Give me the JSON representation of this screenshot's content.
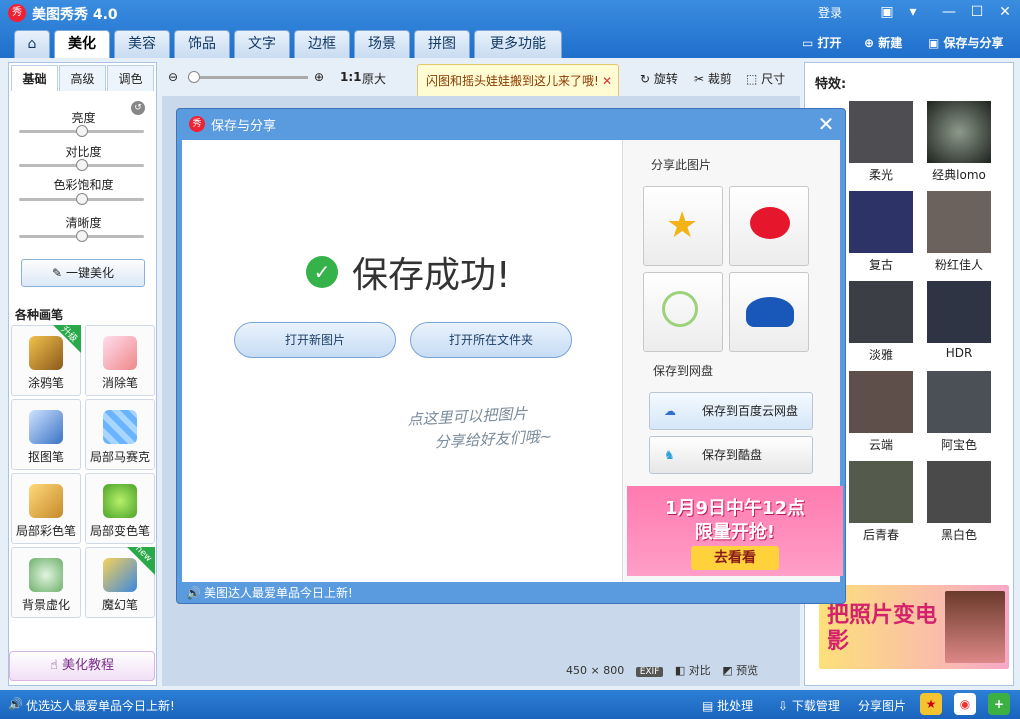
{
  "window": {
    "app_title": "美图秀秀 4.0",
    "logo_char": "秀",
    "login": "登录"
  },
  "main_tabs": [
    "美化",
    "美容",
    "饰品",
    "文字",
    "边框",
    "场景",
    "拼图",
    "更多功能"
  ],
  "header_actions": {
    "open": "打开",
    "new": "新建",
    "save_share": "保存与分享"
  },
  "left_panel": {
    "tabs": [
      "基础",
      "高级",
      "调色"
    ],
    "sliders": [
      {
        "label": "亮度",
        "value": 0.5
      },
      {
        "label": "对比度",
        "value": 0.5
      },
      {
        "label": "色彩饱和度",
        "value": 0.5
      },
      {
        "label": "清晰度",
        "value": 0.5
      }
    ],
    "one_key": "一键美化",
    "brushes_title": "各种画笔",
    "tools": [
      {
        "label": "涂鸦笔",
        "badge": "升级"
      },
      {
        "label": "消除笔",
        "badge": ""
      },
      {
        "label": "抠图笔",
        "badge": ""
      },
      {
        "label": "局部马赛克",
        "badge": ""
      },
      {
        "label": "局部彩色笔",
        "badge": ""
      },
      {
        "label": "局部变色笔",
        "badge": ""
      },
      {
        "label": "背景虚化",
        "badge": ""
      },
      {
        "label": "魔幻笔",
        "badge": "new"
      }
    ],
    "tutorial": "美化教程"
  },
  "toolbar": {
    "ratio": "1:1",
    "original": "原大",
    "tip": "闪图和摇头娃娃搬到这儿来了哦!",
    "rotate": "旋转",
    "crop": "裁剪",
    "size": "尺寸"
  },
  "canvas": {
    "dims": "450 × 800",
    "exif": "EXIF",
    "compare": "对比",
    "preview": "预览"
  },
  "right_panel": {
    "title": "特效:",
    "effects": [
      "柔光",
      "经典lomo",
      "复古",
      "粉红佳人",
      "淡雅",
      "HDR",
      "云端",
      "阿宝色",
      "后青春",
      "黑白色"
    ],
    "ad_text": "把照片变电影"
  },
  "dialog": {
    "title": "保存与分享",
    "success": "保存成功!",
    "open_new": "打开新图片",
    "open_folder": "打开所在文件夹",
    "hint_line1": "点这里可以把图片",
    "hint_line2": "分享给好友们哦~",
    "share_title": "分享此图片",
    "disk_title": "保存到网盘",
    "save_baidu": "保存到百度云网盘",
    "save_kuai": "保存到酷盘",
    "ad_line1": "1月9日中午12点",
    "ad_line2": "限量开抢!",
    "ad_button": "去看看",
    "footer": "美图达人最爱单品今日上新!"
  },
  "status_bar": {
    "left_text": "优选达人最爱单品今日上新!",
    "batch": "批处理",
    "download": "下载管理",
    "share": "分享图片"
  },
  "colors": {
    "brand_blue": "#2b7bd6",
    "success_green": "#36b24a"
  }
}
